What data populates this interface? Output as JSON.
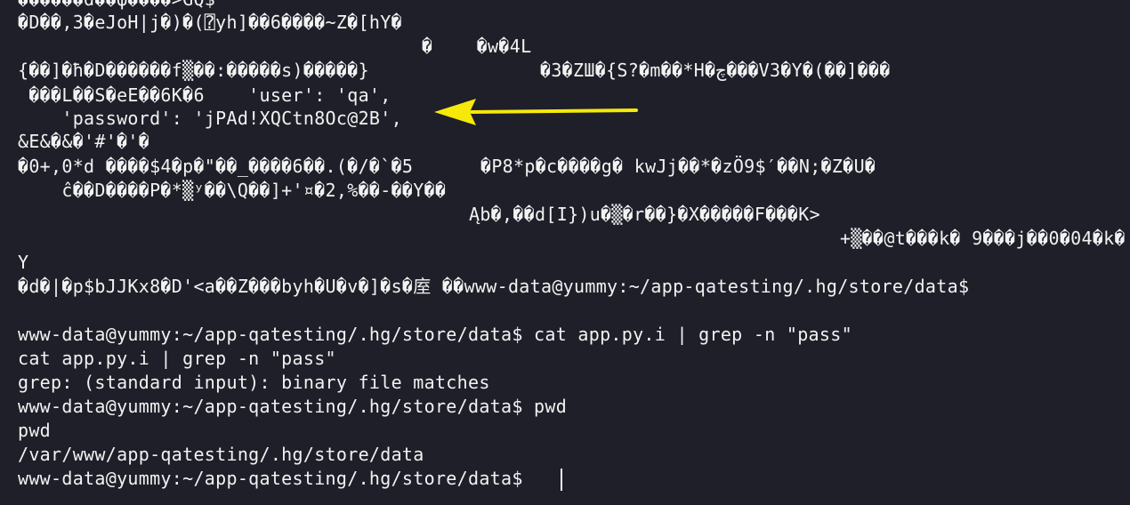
{
  "terminal": {
    "accent_arrow_color": "#f5e90a",
    "lines": [
      "������d��φ����>GQ$",
      "�D��,3�eJoH|j�)�(⍰yh]��6����~Z�[hY�",
      "�    �w�4L",
      "{��]�ħ�D������f▒��:�����s)�����}",
      "�3�ZШ�{S?�m��*H�چ���V3�Y�(��]���",
      " ���L��S�eE��6K�6    'user': 'qa',",
      "    'password': 'jPAd!XQCtn8Oc@2B',",
      "&E&�&�'#'�'�",
      "�0+,0*d ����$4�p�\"��_����6��.(�/�`�5",
      "�P8*p�c����g� kwJj��*�zÖ9$′��N;�Z�U�",
      "    ĉ��D����P�*▒ʸ��\\Q��]+'¤�2,%��-��Y��",
      "Ąb�,��d[I})u�▒�r��}�X�����F���K>",
      "+▒��@t���k� 9���j��0�04�k�",
      "Y",
      "�d�|�p$bJJKx8�D'<a��Z���byh�U�v�]�s�庢 ��www-data@yummy:~/app-qatesting/.hg/store/data$",
      "www-data@yummy:~/app-qatesting/.hg/store/data$ cat app.py.i | grep -n \"pass\"",
      "cat app.py.i | grep -n \"pass\"",
      "grep: (standard input): binary file matches",
      "www-data@yummy:~/app-qatesting/.hg/store/data$ pwd",
      "pwd",
      "/var/www/app-qatesting/.hg/store/data",
      "www-data@yummy:~/app-qatesting/.hg/store/data$ "
    ]
  }
}
